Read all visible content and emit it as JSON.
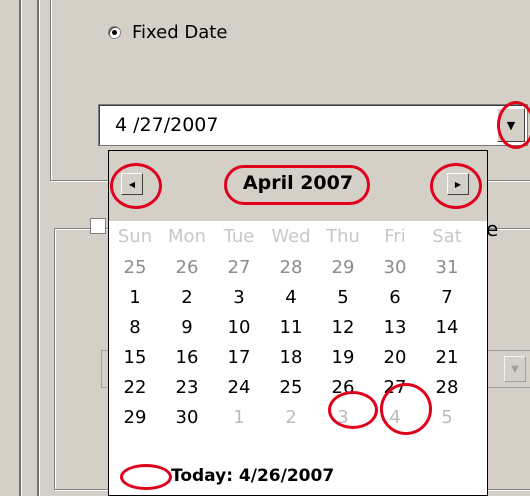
{
  "radio_fixed_date": {
    "label": "Fixed Date",
    "selected": true
  },
  "date_combo": {
    "value": "4 /27/2007"
  },
  "partial_label_letter": "e",
  "calendar": {
    "month_label": "April 2007",
    "weekdays": [
      "Sun",
      "Mon",
      "Tue",
      "Wed",
      "Thu",
      "Fri",
      "Sat"
    ],
    "weeks": [
      [
        "25",
        "26",
        "27",
        "28",
        "29",
        "30",
        "31"
      ],
      [
        "1",
        "2",
        "3",
        "4",
        "5",
        "6",
        "7"
      ],
      [
        "8",
        "9",
        "10",
        "11",
        "12",
        "13",
        "14"
      ],
      [
        "15",
        "16",
        "17",
        "18",
        "19",
        "20",
        "21"
      ],
      [
        "22",
        "23",
        "24",
        "25",
        "26",
        "27",
        "28"
      ],
      [
        "29",
        "30",
        "1",
        "2",
        "3",
        "4",
        "5"
      ]
    ],
    "today_label": "Today: 4/26/2007",
    "selected_day": "27"
  },
  "colors": {
    "annotation_red": "#e0001b",
    "face": "#d4d0c8"
  },
  "icons": {
    "prev": "arrow-left-icon",
    "next": "arrow-right-icon",
    "dropdown": "chevron-down-icon"
  }
}
